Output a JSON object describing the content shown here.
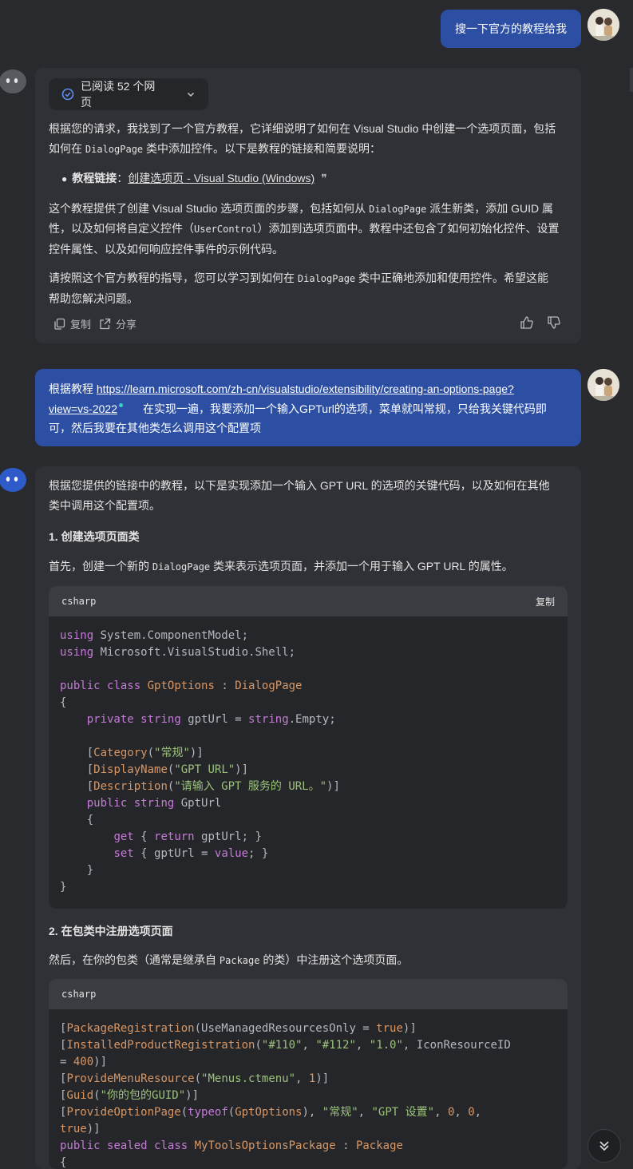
{
  "msg1": {
    "text": "搜一下官方的教程给我"
  },
  "reply1": {
    "sources_label": "已阅读 52 个网页",
    "p1a": "根据您的请求，我找到了一个官方教程，它详细说明了如何在 Visual Studio 中创建一个选项页面，包括",
    "p1b_pre": "如何在 ",
    "p1b_code": "DialogPage",
    "p1b_post": " 类中添加控件。以下是教程的链接和简要说明：",
    "bullet_label": "教程链接",
    "bullet_colon": "：",
    "bullet_link": "创建选项页 - Visual Studio (Windows)",
    "bullet_quote": "❞",
    "p2a_pre": "这个教程提供了创建 Visual Studio 选项页面的步骤，包括如何从 ",
    "p2a_code": "DialogPage",
    "p2a_post": " 派生新类，添加 GUID 属",
    "p2b_pre": "性，以及如何将自定义控件（",
    "p2b_code": "UserControl",
    "p2b_post": "）添加到选项页面中。教程中还包含了如何初始化控件、设置",
    "p2c": "控件属性、以及如何响应控件事件的示例代码。",
    "p3a_pre": "请按照这个官方教程的指导，您可以学习到如何在 ",
    "p3a_code": "DialogPage",
    "p3a_post": " 类中正确地添加和使用控件。希望这能",
    "p3b": "帮助您解决问题。",
    "copy_label": "复制",
    "share_label": "分享"
  },
  "msg2": {
    "pre": "根据教程 ",
    "link1": "https://learn.microsoft.com/zh-cn/visualstudio/extensibility/creating-an-options-page?",
    "link2": "view=vs-2022",
    "rest1": "在实现一遍，我要添加一个输入GPTurl的选项，菜单就叫常规，只给我关键代码即",
    "rest2": "可，然后我要在其他类怎么调用这个配置项"
  },
  "reply2": {
    "intro1": "根据您提供的链接中的教程，以下是实现添加一个输入 GPT URL 的选项的关键代码，以及如何在其他",
    "intro2": "类中调用这个配置项。",
    "h1": "1. 创建选项页面类",
    "s1_pre": "首先，创建一个新的 ",
    "s1_code": "DialogPage",
    "s1_post": " 类来表示选项页面，并添加一个用于输入 GPT URL 的属性。",
    "code1_lang": "csharp",
    "code1_copy": "复制",
    "h2": "2. 在包类中注册选项页面",
    "s2_pre": "然后，在你的包类（通常是继承自 ",
    "s2_code": "Package",
    "s2_post": " 的类）中注册这个选项页面。",
    "code2_lang": "csharp"
  },
  "code1_lines": [
    [
      [
        "kw",
        "using"
      ],
      [
        "pl",
        " System.ComponentModel;"
      ]
    ],
    [
      [
        "kw",
        "using"
      ],
      [
        "pl",
        " Microsoft.VisualStudio.Shell;"
      ]
    ],
    [],
    [
      [
        "kw",
        "public"
      ],
      [
        "pl",
        " "
      ],
      [
        "kw",
        "class"
      ],
      [
        "pl",
        " "
      ],
      [
        "ty",
        "GptOptions"
      ],
      [
        "pl",
        " : "
      ],
      [
        "ty",
        "DialogPage"
      ]
    ],
    [
      [
        "pl",
        "{"
      ]
    ],
    [
      [
        "pl",
        "    "
      ],
      [
        "kw",
        "private"
      ],
      [
        "pl",
        " "
      ],
      [
        "kw",
        "string"
      ],
      [
        "pl",
        " gptUrl = "
      ],
      [
        "kw",
        "string"
      ],
      [
        "pl",
        ".Empty;"
      ]
    ],
    [],
    [
      [
        "pl",
        "    ["
      ],
      [
        "ty",
        "Category"
      ],
      [
        "pl",
        "("
      ],
      [
        "st",
        "\"常规\""
      ],
      [
        "pl",
        ")]"
      ]
    ],
    [
      [
        "pl",
        "    ["
      ],
      [
        "ty",
        "DisplayName"
      ],
      [
        "pl",
        "("
      ],
      [
        "st",
        "\"GPT URL\""
      ],
      [
        "pl",
        ")]"
      ]
    ],
    [
      [
        "pl",
        "    ["
      ],
      [
        "ty",
        "Description"
      ],
      [
        "pl",
        "("
      ],
      [
        "st",
        "\"请输入 GPT 服务的 URL。\""
      ],
      [
        "pl",
        ")]"
      ]
    ],
    [
      [
        "pl",
        "    "
      ],
      [
        "kw",
        "public"
      ],
      [
        "pl",
        " "
      ],
      [
        "kw",
        "string"
      ],
      [
        "pl",
        " GptUrl"
      ]
    ],
    [
      [
        "pl",
        "    {"
      ]
    ],
    [
      [
        "pl",
        "        "
      ],
      [
        "kw",
        "get"
      ],
      [
        "pl",
        " { "
      ],
      [
        "kw",
        "return"
      ],
      [
        "pl",
        " gptUrl; }"
      ]
    ],
    [
      [
        "pl",
        "        "
      ],
      [
        "kw",
        "set"
      ],
      [
        "pl",
        " { gptUrl = "
      ],
      [
        "kw",
        "value"
      ],
      [
        "pl",
        "; }"
      ]
    ],
    [
      [
        "pl",
        "    }"
      ]
    ],
    [
      [
        "pl",
        "}"
      ]
    ]
  ],
  "code2_lines": [
    [
      [
        "pl",
        "["
      ],
      [
        "ty",
        "PackageRegistration"
      ],
      [
        "pl",
        "(UseManagedResourcesOnly = "
      ],
      [
        "ty",
        "true"
      ],
      [
        "pl",
        ")]"
      ]
    ],
    [
      [
        "pl",
        "["
      ],
      [
        "ty",
        "InstalledProductRegistration"
      ],
      [
        "pl",
        "("
      ],
      [
        "st",
        "\"#110\""
      ],
      [
        "pl",
        ", "
      ],
      [
        "st",
        "\"#112\""
      ],
      [
        "pl",
        ", "
      ],
      [
        "st",
        "\"1.0\""
      ],
      [
        "pl",
        ", IconResourceID"
      ]
    ],
    [
      [
        "pl",
        "= "
      ],
      [
        "ty",
        "400"
      ],
      [
        "pl",
        ")]"
      ]
    ],
    [
      [
        "pl",
        "["
      ],
      [
        "ty",
        "ProvideMenuResource"
      ],
      [
        "pl",
        "("
      ],
      [
        "st",
        "\"Menus.ctmenu\""
      ],
      [
        "pl",
        ", "
      ],
      [
        "ty",
        "1"
      ],
      [
        "pl",
        ")]"
      ]
    ],
    [
      [
        "pl",
        "["
      ],
      [
        "ty",
        "Guid"
      ],
      [
        "pl",
        "("
      ],
      [
        "st",
        "\"你的包的GUID\""
      ],
      [
        "pl",
        ")]"
      ]
    ],
    [
      [
        "pl",
        "["
      ],
      [
        "ty",
        "ProvideOptionPage"
      ],
      [
        "pl",
        "("
      ],
      [
        "kw",
        "typeof"
      ],
      [
        "pl",
        "("
      ],
      [
        "ty",
        "GptOptions"
      ],
      [
        "pl",
        "), "
      ],
      [
        "st",
        "\"常规\""
      ],
      [
        "pl",
        ", "
      ],
      [
        "st",
        "\"GPT 设置\""
      ],
      [
        "pl",
        ", "
      ],
      [
        "ty",
        "0"
      ],
      [
        "pl",
        ", "
      ],
      [
        "ty",
        "0"
      ],
      [
        "pl",
        ","
      ]
    ],
    [
      [
        "ty",
        "true"
      ],
      [
        "pl",
        ")]"
      ]
    ],
    [
      [
        "kw",
        "public"
      ],
      [
        "pl",
        " "
      ],
      [
        "kw",
        "sealed"
      ],
      [
        "pl",
        " "
      ],
      [
        "kw",
        "class"
      ],
      [
        "pl",
        " "
      ],
      [
        "ty",
        "MyToolsOptionsPackage"
      ],
      [
        "pl",
        " : "
      ],
      [
        "ty",
        "Package"
      ]
    ],
    [
      [
        "pl",
        "{"
      ]
    ]
  ],
  "colors": {
    "user_bubble": "#2c4fa3",
    "bot_bubble": "#303136",
    "background": "#292a2d"
  }
}
